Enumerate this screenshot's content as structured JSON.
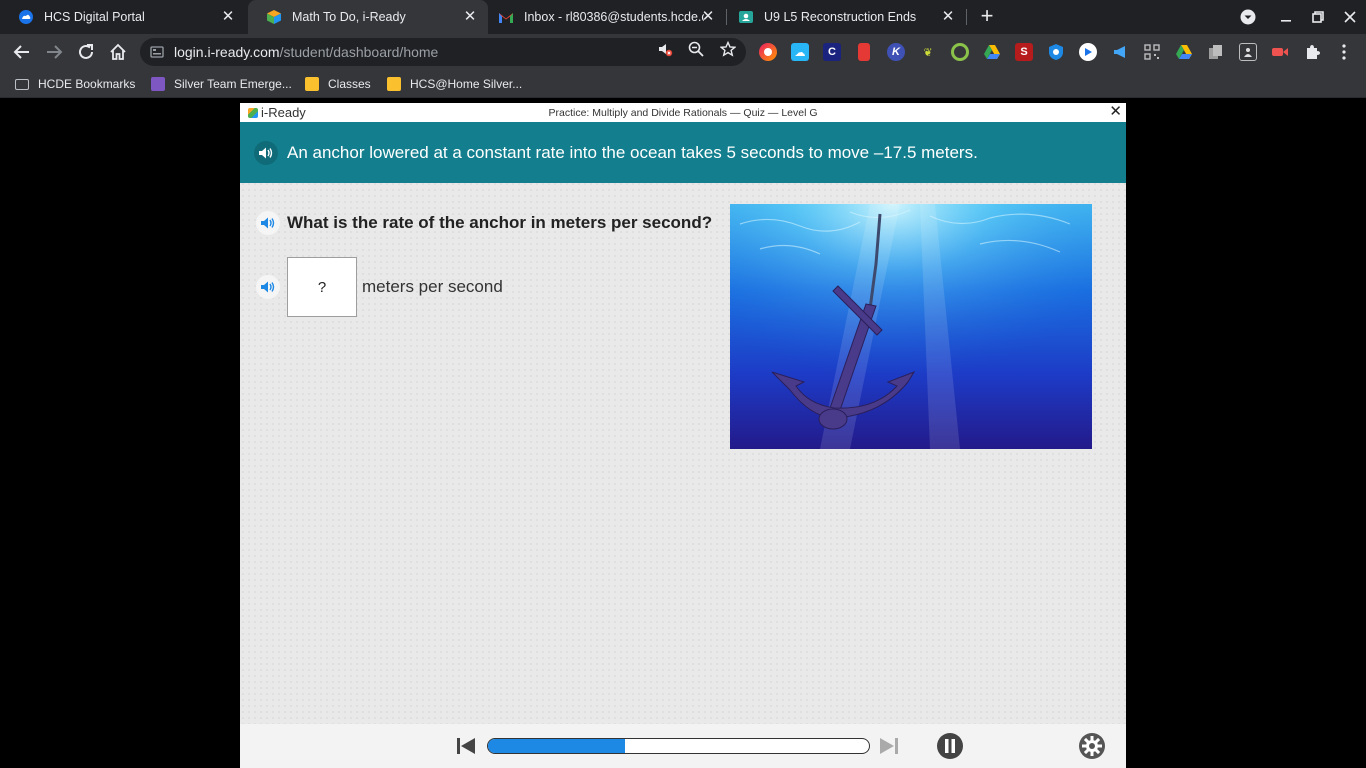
{
  "browser": {
    "tabs": [
      {
        "title": "HCS Digital Portal",
        "active": false,
        "icon": "cloud-portal-icon"
      },
      {
        "title": "Math To Do, i-Ready",
        "active": true,
        "icon": "iready-cube-icon"
      },
      {
        "title": "Inbox - rl80386@students.hcde.o",
        "active": false,
        "icon": "gmail-icon"
      },
      {
        "title": "U9 L5 Reconstruction Ends",
        "active": false,
        "icon": "classroom-assignment-icon"
      }
    ],
    "url_host": "login.i-ready.com",
    "url_path": "/student/dashboard/home",
    "bookmarks": [
      {
        "label": "HCDE Bookmarks",
        "icon": "folder-icon"
      },
      {
        "label": "Silver Team Emerge...",
        "icon": "list-icon"
      },
      {
        "label": "Classes",
        "icon": "classroom-icon"
      },
      {
        "label": "HCS@Home Silver...",
        "icon": "folder-icon"
      }
    ],
    "extension_letters": {
      "c": "C",
      "k": "K",
      "s": "S"
    }
  },
  "lesson": {
    "brand": "i-Ready",
    "title": "Practice: Multiply and Divide Rationals — Quiz — Level G",
    "prompt": "An anchor lowered at a constant rate into the ocean takes 5 seconds to move –17.5 meters.",
    "question": "What is the rate of the anchor in meters per second?",
    "answer_placeholder": "?",
    "unit_label": "meters per second",
    "image": "anchor-underwater",
    "progress_fraction": 0.36,
    "accent_color": "#137f8e",
    "progress_color": "#1e88e5"
  }
}
